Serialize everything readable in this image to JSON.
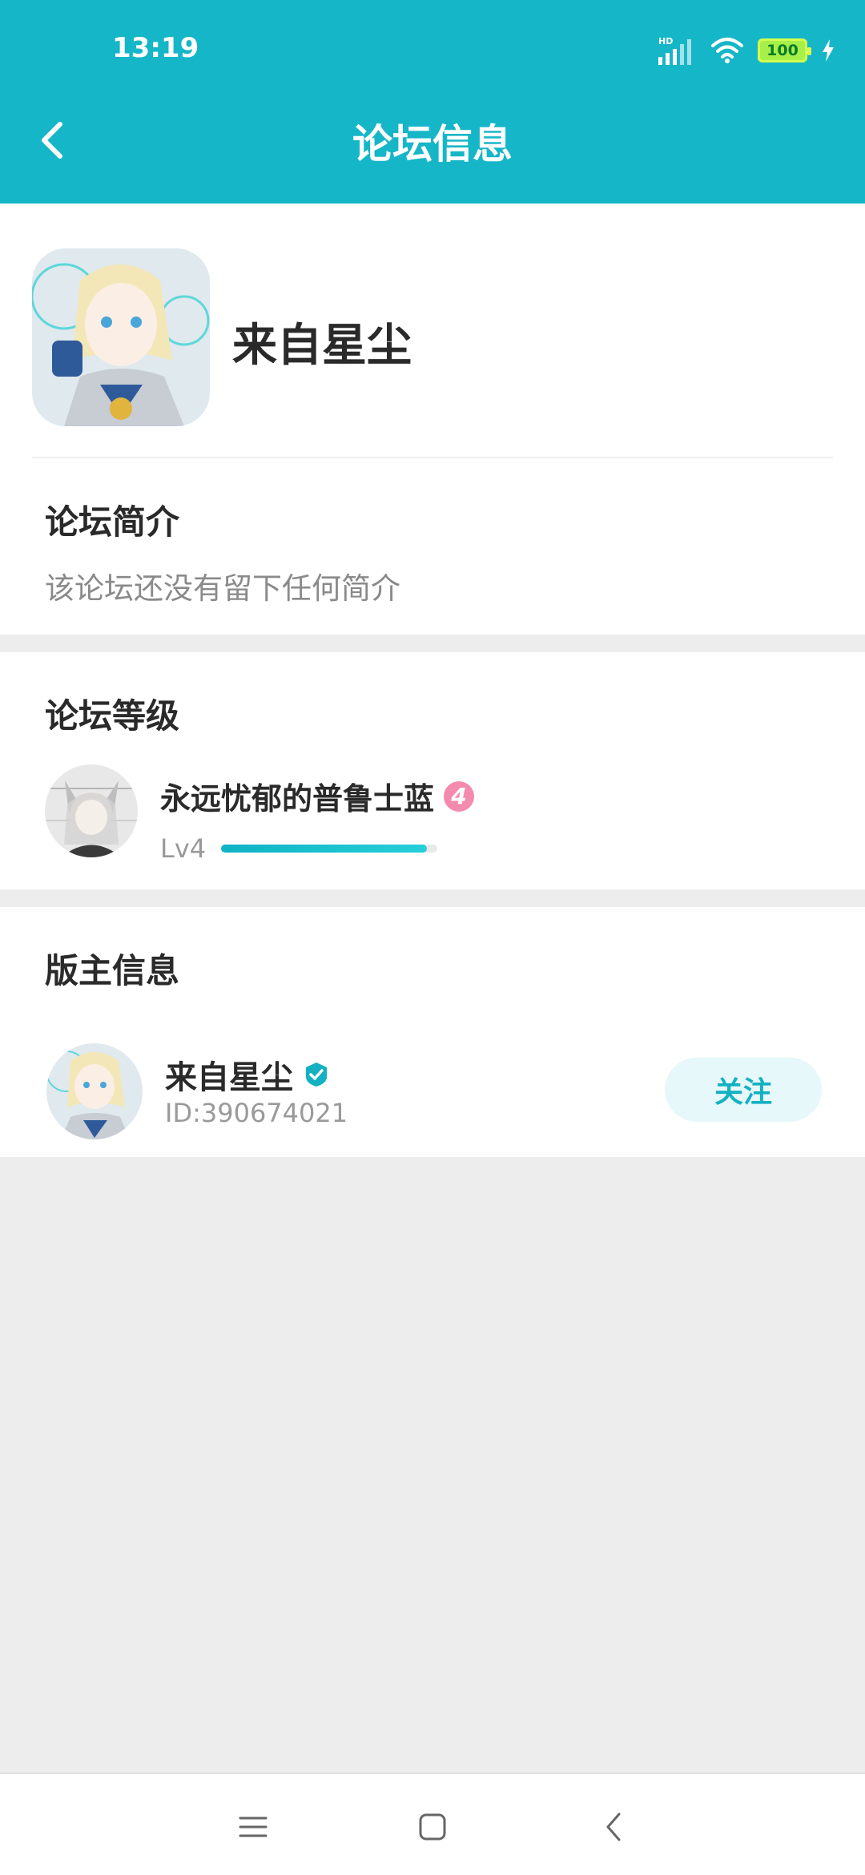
{
  "status_bar": {
    "time": "13:19",
    "battery": "100",
    "network_label": "HD"
  },
  "header": {
    "title": "论坛信息",
    "back_icon": "chevron-left-icon"
  },
  "forum": {
    "name": "来自星尘"
  },
  "intro": {
    "heading": "论坛简介",
    "text": "该论坛还没有留下任何简介"
  },
  "level": {
    "heading": "论坛等级",
    "user_name": "永远忧郁的普鲁士蓝",
    "badge": "4",
    "label": "Lv4",
    "progress": 0.95
  },
  "moderator": {
    "heading": "版主信息",
    "name": "来自星尘",
    "id_text": "ID:390674021",
    "follow_label": "关注"
  },
  "colors": {
    "accent": "#15b6c7",
    "badge_pink": "#f58aaf",
    "background": "#ededed"
  },
  "nav": {
    "items": [
      "menu-icon",
      "home-square-icon",
      "back-chevron-icon"
    ]
  }
}
